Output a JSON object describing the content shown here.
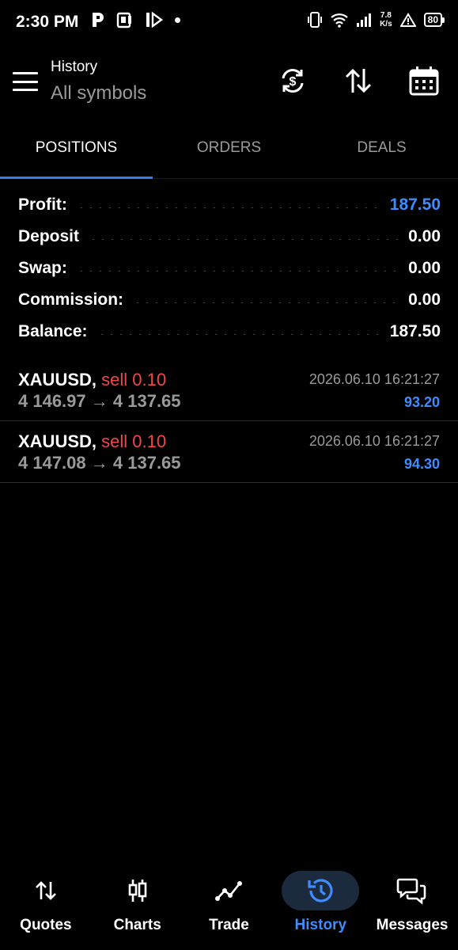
{
  "status_bar": {
    "time": "2:30 PM",
    "net_speed_value": "7.8",
    "net_speed_unit": "K/s",
    "battery": "80"
  },
  "header": {
    "title": "History",
    "subtitle": "All symbols",
    "actions": [
      "currency-sync-icon",
      "sort-icon",
      "calendar-icon"
    ]
  },
  "tabs": [
    {
      "label": "POSITIONS",
      "active": true
    },
    {
      "label": "ORDERS",
      "active": false
    },
    {
      "label": "DEALS",
      "active": false
    }
  ],
  "summary": {
    "profit_label": "Profit:",
    "profit_value": "187.50",
    "deposit_label": "Deposit",
    "deposit_value": "0.00",
    "swap_label": "Swap:",
    "swap_value": "0.00",
    "commission_label": "Commission:",
    "commission_value": "0.00",
    "balance_label": "Balance:",
    "balance_value": "187.50"
  },
  "positions": [
    {
      "symbol": "XAUUSD,",
      "side": "sell 0.10",
      "open_price": "4 146.97",
      "arrow": "→",
      "close_price": "4 137.65",
      "time": "2026.06.10 16:21:27",
      "profit": "93.20"
    },
    {
      "symbol": "XAUUSD,",
      "side": "sell 0.10",
      "open_price": "4 147.08",
      "arrow": "→",
      "close_price": "4 137.65",
      "time": "2026.06.10 16:21:27",
      "profit": "94.30"
    }
  ],
  "bottom_nav": [
    {
      "label": "Quotes",
      "icon": "updown-arrows-icon",
      "active": false
    },
    {
      "label": "Charts",
      "icon": "candlestick-icon",
      "active": false
    },
    {
      "label": "Trade",
      "icon": "trade-line-icon",
      "active": false
    },
    {
      "label": "History",
      "icon": "history-icon",
      "active": true
    },
    {
      "label": "Messages",
      "icon": "messages-icon",
      "active": false
    }
  ],
  "colors": {
    "accent": "#3f8cff",
    "sell": "#ef4848",
    "muted": "#9a9a9a",
    "background": "#000000"
  }
}
